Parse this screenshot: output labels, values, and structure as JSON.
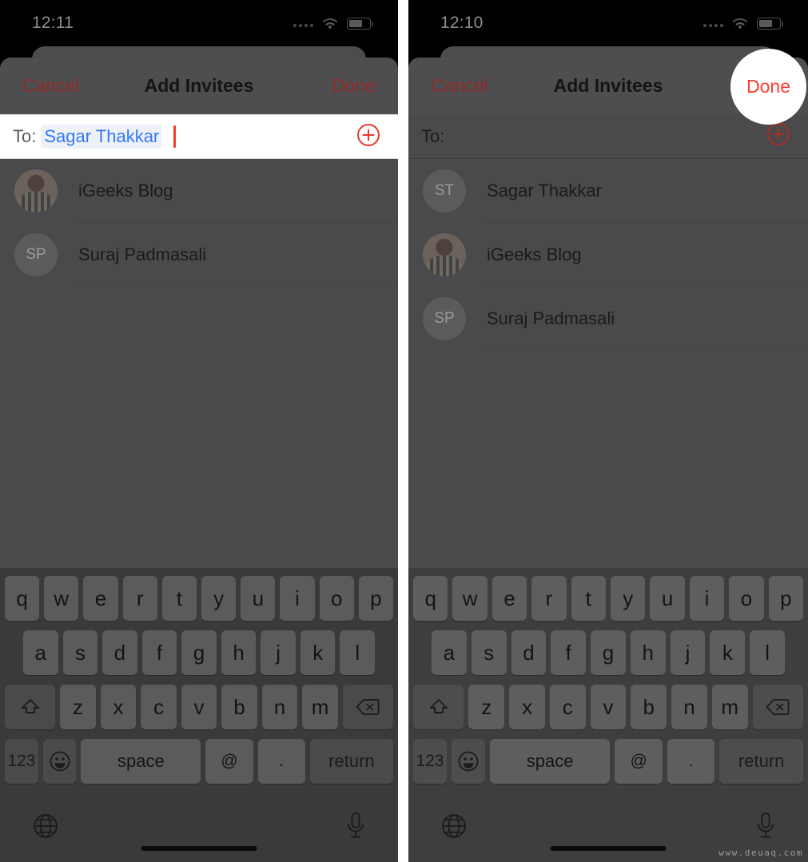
{
  "meta": {
    "watermark": "www.deuaq.com"
  },
  "panels": [
    {
      "id": "left",
      "status": {
        "time": "12:11"
      },
      "navbar": {
        "cancel": "Cancel",
        "title": "Add Invitees",
        "done": "Done"
      },
      "to_field": {
        "label": "To:",
        "token": "Sagar Thakkar",
        "placeholder": "",
        "add_icon": "plus-circle-icon",
        "caret_visible": true
      },
      "contacts": [
        {
          "name": "iGeeks Blog",
          "initials": "",
          "avatar": "photo"
        },
        {
          "name": "Suraj Padmasali",
          "initials": "SP",
          "avatar": "initials"
        }
      ],
      "highlight": null
    },
    {
      "id": "right",
      "status": {
        "time": "12:10"
      },
      "navbar": {
        "cancel": "Cancel",
        "title": "Add Invitees",
        "done": "Done"
      },
      "to_field": {
        "label": "To:",
        "token": "",
        "placeholder": "",
        "add_icon": "plus-circle-icon",
        "caret_visible": false
      },
      "contacts": [
        {
          "name": "Sagar Thakkar",
          "initials": "ST",
          "avatar": "initials"
        },
        {
          "name": "iGeeks Blog",
          "initials": "",
          "avatar": "photo"
        },
        {
          "name": "Suraj Padmasali",
          "initials": "SP",
          "avatar": "initials"
        }
      ],
      "highlight": {
        "label": "Done",
        "target": "done-button"
      }
    }
  ],
  "keyboard": {
    "row1": [
      "q",
      "w",
      "e",
      "r",
      "t",
      "y",
      "u",
      "i",
      "o",
      "p"
    ],
    "row2": [
      "a",
      "s",
      "d",
      "f",
      "g",
      "h",
      "j",
      "k",
      "l"
    ],
    "row3": [
      "z",
      "x",
      "c",
      "v",
      "b",
      "n",
      "m"
    ],
    "shift_icon": "shift-arrow-icon",
    "backspace_icon": "backspace-icon",
    "numbers_key": "123",
    "emoji_icon": "emoji-smiley-icon",
    "space_key": "space",
    "at_key": "@",
    "period_key": ".",
    "return_key": "return",
    "globe_icon": "globe-icon",
    "mic_icon": "microphone-icon"
  },
  "colors": {
    "accent_red": "#ff3b30",
    "token_blue": "#3478f6",
    "dim_overlay": "#4a4a4c",
    "keyboard_bg": "#3a3a3c",
    "key_bg": "#5b5b5d"
  }
}
